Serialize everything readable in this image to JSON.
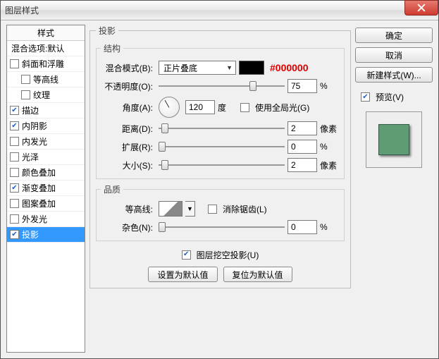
{
  "window": {
    "title": "图层样式"
  },
  "close_icon": "close",
  "sidebar": {
    "header": "样式",
    "blend_opts": "混合选项:默认",
    "items": [
      {
        "label": "斜面和浮雕",
        "checked": false,
        "indent": false
      },
      {
        "label": "等高线",
        "checked": false,
        "indent": true
      },
      {
        "label": "纹理",
        "checked": false,
        "indent": true
      },
      {
        "label": "描边",
        "checked": true,
        "indent": false
      },
      {
        "label": "内阴影",
        "checked": true,
        "indent": false
      },
      {
        "label": "内发光",
        "checked": false,
        "indent": false
      },
      {
        "label": "光泽",
        "checked": false,
        "indent": false
      },
      {
        "label": "颜色叠加",
        "checked": false,
        "indent": false
      },
      {
        "label": "渐变叠加",
        "checked": true,
        "indent": false
      },
      {
        "label": "图案叠加",
        "checked": false,
        "indent": false
      },
      {
        "label": "外发光",
        "checked": false,
        "indent": false
      },
      {
        "label": "投影",
        "checked": true,
        "indent": false,
        "selected": true
      }
    ]
  },
  "main": {
    "group_title": "投影",
    "structure_title": "结构",
    "blend_mode_label": "混合模式(B):",
    "blend_mode_value": "正片叠底",
    "color_hex": "#000000",
    "color_swatch": "#000000",
    "opacity_label": "不透明度(O):",
    "opacity_value": "75",
    "opacity_unit": "%",
    "angle_label": "角度(A):",
    "angle_value": "120",
    "angle_unit": "度",
    "global_light_label": "使用全局光(G)",
    "global_light_checked": false,
    "distance_label": "距离(D):",
    "distance_value": "2",
    "distance_unit": "像素",
    "spread_label": "扩展(R):",
    "spread_value": "0",
    "spread_unit": "%",
    "size_label": "大小(S):",
    "size_value": "2",
    "size_unit": "像素",
    "quality_title": "品质",
    "contour_label": "等高线:",
    "antialias_label": "消除锯齿(L)",
    "antialias_checked": false,
    "noise_label": "杂色(N):",
    "noise_value": "0",
    "noise_unit": "%",
    "knockout_label": "图层挖空投影(U)",
    "knockout_checked": true,
    "btn_make_default": "设置为默认值",
    "btn_reset_default": "复位为默认值"
  },
  "right": {
    "ok": "确定",
    "cancel": "取消",
    "new_style": "新建样式(W)...",
    "preview_label": "预览(V)",
    "preview_checked": true
  }
}
